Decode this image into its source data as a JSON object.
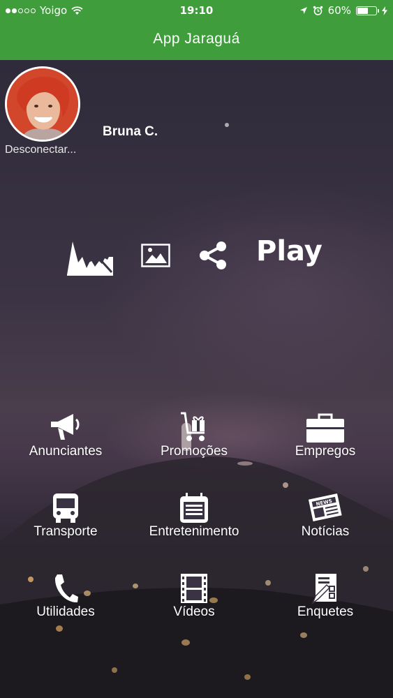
{
  "status_bar": {
    "carrier": "Yoigo",
    "time": "19:10",
    "battery_percent": "60%",
    "battery_level": 0.6,
    "signal_dots_filled": 2,
    "signal_dots_total": 5
  },
  "nav": {
    "title": "App Jaraguá"
  },
  "profile": {
    "name": "Bruna C.",
    "disconnect_label": "Desconectar..."
  },
  "actions": {
    "play_label": "Play",
    "icons": [
      "chart-icon",
      "image-icon",
      "share-icon"
    ]
  },
  "menu": [
    {
      "label": "Anunciantes",
      "icon": "megaphone-icon"
    },
    {
      "label": "Promoções",
      "icon": "gift-cart-icon"
    },
    {
      "label": "Empregos",
      "icon": "briefcase-icon"
    },
    {
      "label": "Transporte",
      "icon": "bus-icon"
    },
    {
      "label": "Entretenimento",
      "icon": "calendar-icon"
    },
    {
      "label": "Notícias",
      "icon": "newspaper-icon"
    },
    {
      "label": "Utilidades",
      "icon": "phone-icon"
    },
    {
      "label": "Vídeos",
      "icon": "film-icon"
    },
    {
      "label": "Enquetes",
      "icon": "poll-icon"
    }
  ],
  "colors": {
    "accent": "#3f9e3b",
    "text": "#ffffff"
  }
}
